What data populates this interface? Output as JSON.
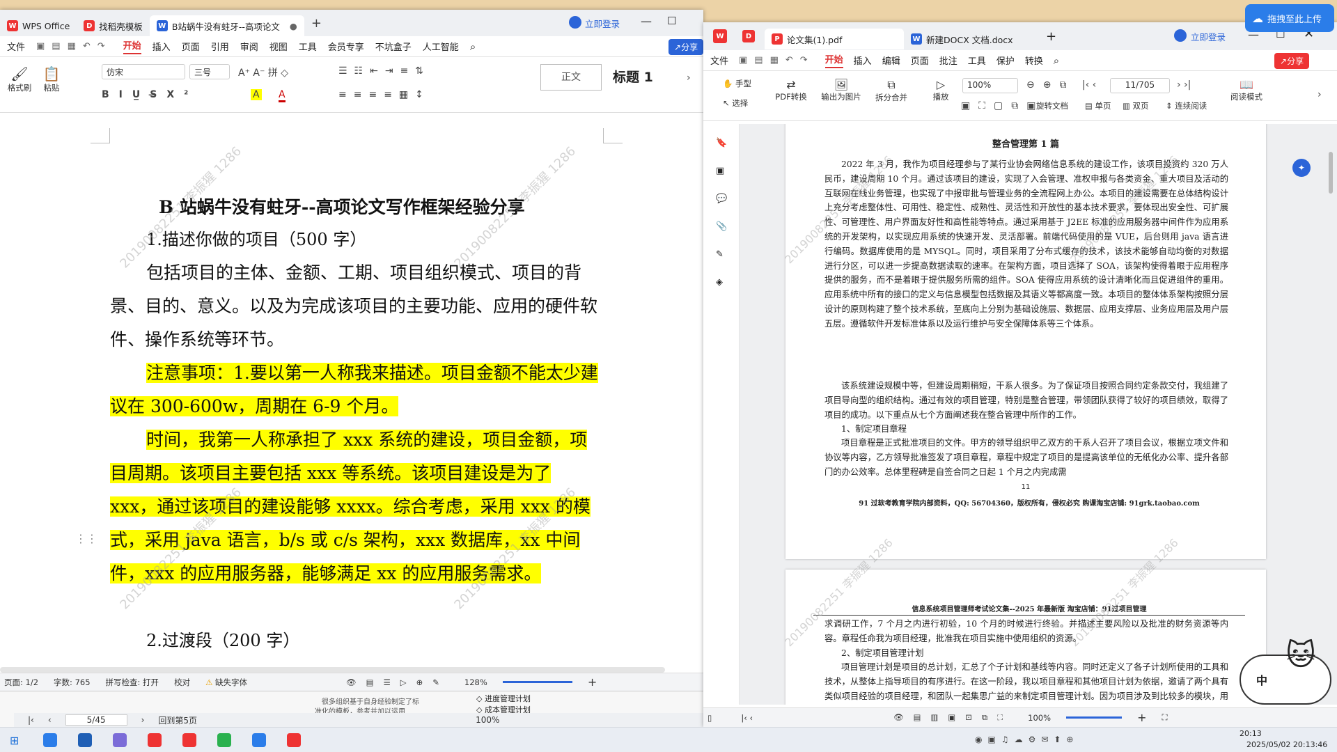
{
  "left_window": {
    "tabs": [
      "WPS Office",
      "找稻壳模板",
      "B站蜗牛没有蛀牙--高项论文"
    ],
    "login": "立即登录",
    "menu": [
      "文件",
      "开始",
      "插入",
      "页面",
      "引用",
      "审阅",
      "视图",
      "工具",
      "会员专享",
      "不坑盒子",
      "人工智能"
    ],
    "share": "分享",
    "toolbar": {
      "format_painter": "格式刷",
      "paste": "粘贴",
      "font": "仿宋",
      "size": "三号",
      "style_normal": "正文",
      "style_heading": "标题 1"
    },
    "document": {
      "title": "B 站蜗牛没有蛀牙--高项论文写作框架经验分享",
      "h1": "1.描述你做的项目（500 字）",
      "p1": "包括项目的主体、金额、工期、项目组织模式、项目的背景、目的、意义。以及为完成该项目的主要功能、应用的硬件软件、操作系统等环节。",
      "p2": "注意事项：1.要以第一人称我来描述。项目金额不能太少建议在 300-600w，周期在 6-9 个月。",
      "p3": "时间，我第一人称承担了 xxx 系统的建设，项目金额，项目周期。该项目主要包括 xxx 等系统。该项目建设是为了 xxx，通过该项目的建设能够 xxxx。综合考虑，采用 xxx 的模式，采用 java 语言，b/s 或 c/s 架构，xxx 数据库，xx 中间件，xxx 的应用服务器，能够满足 xx 的应用服务需求。",
      "h2": "2.过渡段（200 字）",
      "watermark": "20190082251 李振猩 1286"
    },
    "status": {
      "page": "页面: 1/2",
      "words": "字数: 765",
      "spell": "拼写检查: 打开",
      "proof": "校对",
      "missing_font": "缺失字体",
      "zoom": "128%"
    }
  },
  "background_window": {
    "page": "5/45",
    "back": "回到第5页",
    "zoom": "100%",
    "items": [
      "进度管理计划",
      "成本管理计划"
    ],
    "snippet1": "很多组织基于自身经验制定了标",
    "snippet2": "准化的模板，参考并加以运用"
  },
  "right_window": {
    "tabs": [
      "论文集(1).pdf",
      "新建DOCX 文档.docx"
    ],
    "login": "立即登录",
    "menu": [
      "文件",
      "开始",
      "插入",
      "编辑",
      "页面",
      "批注",
      "工具",
      "保护",
      "转换"
    ],
    "share": "分享",
    "toolbar": {
      "hand": "手型",
      "select": "选择",
      "pdf_convert": "PDF转换",
      "export_image": "输出为图片",
      "split_merge": "拆分合并",
      "play": "播放",
      "zoom": "100%",
      "page": "11/705",
      "rotate": "旋转文档",
      "single": "单页",
      "double": "双页",
      "continuous": "连续阅读",
      "read_mode": "阅读模式"
    },
    "page1": {
      "title": "整合管理第 1 篇",
      "body1": "2022 年 3 月，我作为项目经理参与了某行业协会网络信息系统的建设工作，该项目投资约 320 万人民币，建设周期 10 个月。通过该项目的建设，实现了入会管理、准权申报与各类资金、重大项目及活动的互联网在线业务管理，也实现了中报审批与管理业务的全流程网上办公。本项目的建设需要在总体结构设计上充分考虑整体性、可用性、稳定性、成熟性、灵活性和开放性的基本技术要求，要体现出安全性、可扩展性、可管理性、用户界面友好性和高性能等特点。通过采用基于 J2EE 标准的应用服务器中间件作为应用系统的开发架构，以实现应用系统的快速开发、灵活部署。前端代码使用的是 VUE，后台则用 java 语言进行编码。数据库使用的是 MYSQL。同时，项目采用了分布式缓存的技术，该技术能够自动均衡的对数据进行分区，可以进一步提高数据读取的速率。在架构方面，项目选择了 SOA，该架构使得着眼于应用程序提供的服务，而不是着眼于提供服务所需的组件。SOA 使得应用系统的设计清晰化而且促进组件的重用。应用系统中所有的接口的定义与信息模型包括数据及其语义等都高度一致。本项目的整体体系架构按照分层设计的原则构建了整个技术系统，至底向上分别为基础设施层、数据层、应用支撑层、业务应用层及用户层五层。遵循软件开发标准体系以及运行维护与安全保障体系等三个体系。",
      "body2": "该系统建设规模中等，但建设周期稍短，干系人很多。为了保证项目按照合同约定条款交付，我组建了项目导向型的组织结构。通过有效的项目管理，特别是整合管理，带领团队获得了较好的项目绩效，取得了项目的成功。以下重点从七个方面阐述我在整合管理中所作的工作。",
      "h1": "1、制定项目章程",
      "body3": "项目章程是正式批准项目的文件。甲方的领导组织甲乙双方的干系人召开了项目会议，根据立项文件和协议等内容，乙方领导批准签发了项目章程，章程中规定了项目的是提高该单位的无纸化办公率、提升各部门的办公效率。总体里程碑是自签合同之日起 1 个月之内完成需",
      "page_no": "11",
      "footer": "91 过软考教育学院内部资料，QQ: 56704360，版权所有，侵权必究 购课淘宝店铺: 91grk.taobao.com"
    },
    "page2": {
      "header": "信息系统项目管理师考试论文集--2025 年最新版        淘宝店铺：91过项目管理",
      "body1": "求调研工作，7 个月之内进行初验，10 个月的时候进行终验。并描述主要风险以及批准的财务资源等内容。章程任命我为项目经理，批准我在项目实施中使用组织的资源。",
      "h2": "2、制定项目管理计划",
      "body2": "项目管理计划是项目的总计划，汇总了个子计划和基线等内容。同时还定义了各子计划所使用的工具和技术，从整体上指导项目的有序进行。在这一阶段，我以项目章程和其他项目计划为依据，邀请了两个具有类似项目经验的项目经理，和团队一起集思广益的来制定项目管理计划。因为项目涉及到比较多的模块，用户的利益相关者也比较多，所以我着重对范围和沟通"
    },
    "status_zoom": "100%"
  },
  "overlay": {
    "drag_button": "拖拽至此上传",
    "ime": "中"
  },
  "taskbar": {
    "time": "20:13",
    "datetime": "2025/05/02 20:13:46"
  }
}
